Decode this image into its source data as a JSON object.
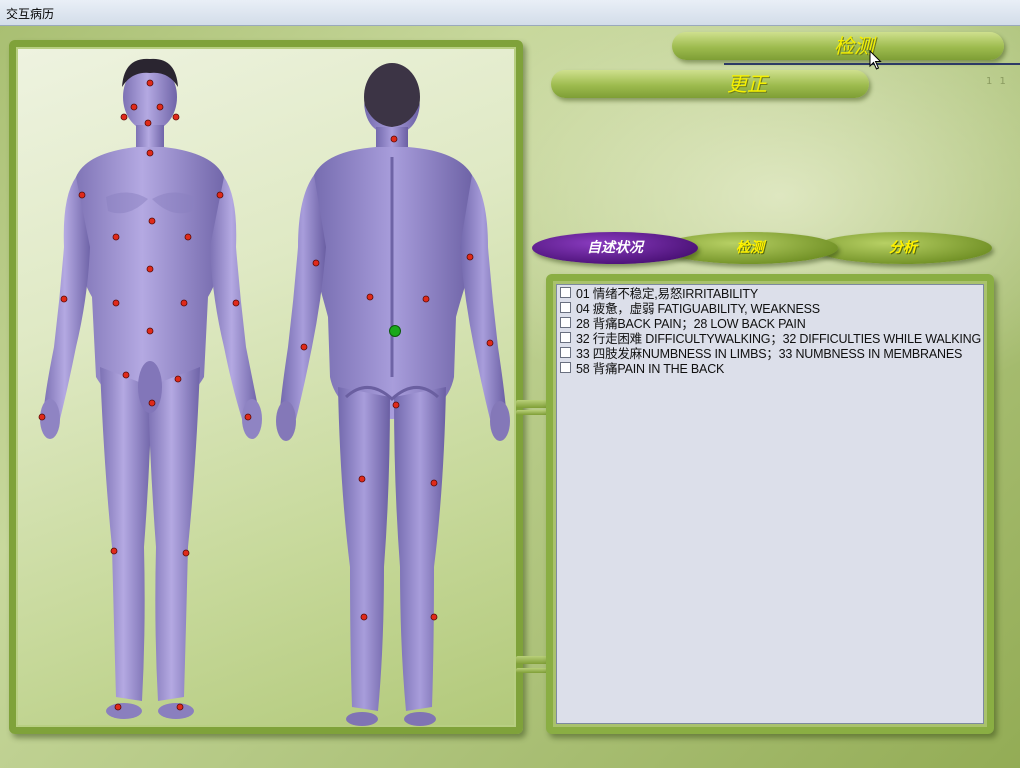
{
  "window": {
    "title": "交互病历"
  },
  "buttons": {
    "detect": "检测",
    "correct": "更正"
  },
  "corner_text": "1  1",
  "tabs": [
    {
      "label": "自述状况",
      "active": true
    },
    {
      "label": "检测",
      "active": false
    },
    {
      "label": "分析",
      "active": false
    }
  ],
  "symptoms": [
    {
      "text": "01 情绪不稳定,易怒IRRITABILITY",
      "checked": false
    },
    {
      "text": "04 疲惫，虚弱 FATIGUABILITY, WEAKNESS",
      "checked": false
    },
    {
      "text": "28 背痛BACK PAIN；28  LOW  BACK  PAIN",
      "checked": false
    },
    {
      "text": "32 行走困难 DIFFICULTYWALKING；32  DIFFICULTIES  WHILE  WALKING",
      "checked": false
    },
    {
      "text": "33 四肢发麻NUMBNESS IN LIMBS；33  NUMBNESS  IN  MEMBRANES",
      "checked": false
    },
    {
      "text": "58 背痛PAIN IN THE BACK",
      "checked": false
    }
  ],
  "colors": {
    "panel_border": "#7fa23a",
    "body_skin": "#9b8fce",
    "point_red": "#e02a1a",
    "point_selected": "#1aa81a",
    "tab_active": "#5a1a8c",
    "button_text": "#f6f000"
  },
  "icons": {
    "cursor": "mouse-pointer-icon",
    "checkbox": "checkbox-icon"
  }
}
